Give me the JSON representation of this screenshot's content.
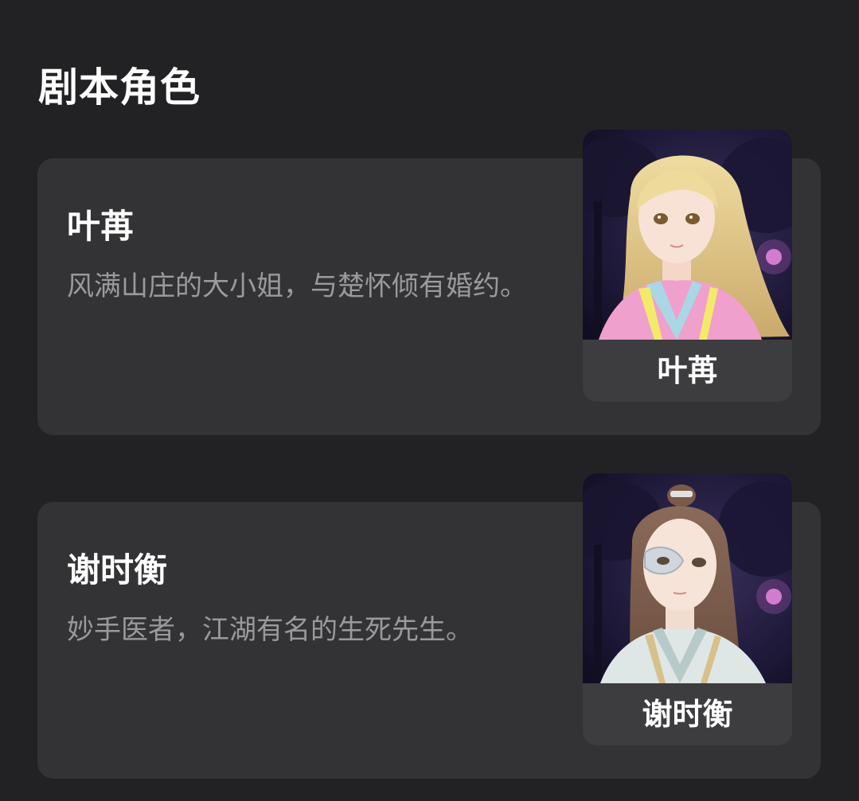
{
  "section": {
    "title": "剧本角色"
  },
  "characters": [
    {
      "name": "叶苒",
      "description": "风满山庄的大小姐，与楚怀倾有婚约。",
      "portrait_label": "叶苒"
    },
    {
      "name": "谢时衡",
      "description": "妙手医者，江湖有名的生死先生。",
      "portrait_label": "谢时衡"
    }
  ],
  "colors": {
    "background": "#222224",
    "card": "#333335",
    "label_bar": "#3d3d40",
    "description_text": "#9a9a9e"
  }
}
